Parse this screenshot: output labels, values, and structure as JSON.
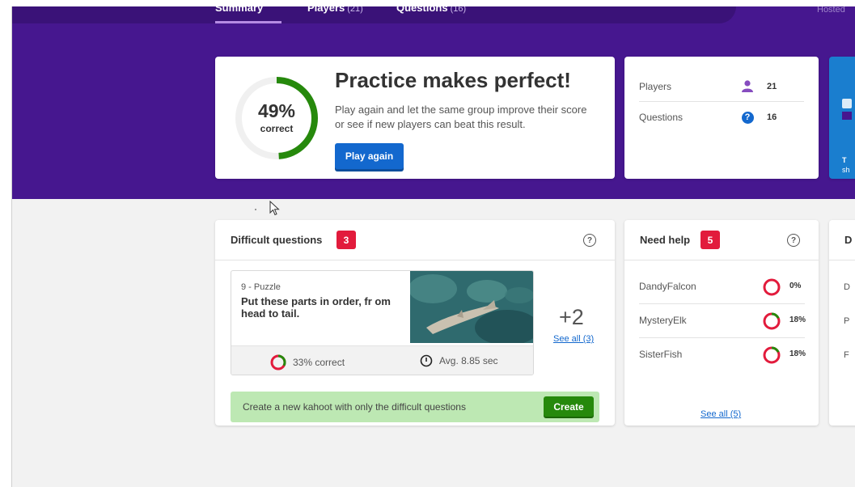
{
  "tabs": [
    {
      "label": "Summary",
      "count": ""
    },
    {
      "label": "Players",
      "count": "(21)"
    },
    {
      "label": "Questions",
      "count": "(16)"
    }
  ],
  "hosted_label": "Hosted",
  "hero": {
    "percent": "49%",
    "percent_value": 0.49,
    "percent_label": "correct",
    "title": "Practice makes perfect!",
    "text": "Play again and let the same group improve their score or see if new players can beat this result.",
    "button": "Play again"
  },
  "stats": {
    "players_label": "Players",
    "players_value": "21",
    "questions_label": "Questions",
    "questions_value": "16"
  },
  "promo": {
    "line1": "T",
    "line2": "sh"
  },
  "difficult": {
    "title": "Difficult questions",
    "count": "3",
    "question": {
      "meta": "9 - Puzzle",
      "title": "Put these parts in order, fr om head to tail.",
      "correct": "33% correct",
      "correct_value": 0.33,
      "avg": "Avg. 8.85 sec"
    },
    "more": "+2",
    "see_all": "See all (3)",
    "create_text": "Create a new kahoot with only the difficult questions",
    "create_button": "Create"
  },
  "need_help": {
    "title": "Need help",
    "count": "5",
    "players": [
      {
        "name": "DandyFalcon",
        "value": "0%",
        "fraction": 0
      },
      {
        "name": "MysteryElk",
        "value": "18%",
        "fraction": 0.18
      },
      {
        "name": "SisterFish",
        "value": "18%",
        "fraction": 0.18
      }
    ],
    "see_all": "See all (5)"
  },
  "third_panel": {
    "title": "D",
    "rows": [
      "D",
      "P",
      "F"
    ]
  },
  "colors": {
    "purple": "#46178f",
    "blue": "#1368ce",
    "green": "#26890c",
    "red": "#e21b3c"
  }
}
